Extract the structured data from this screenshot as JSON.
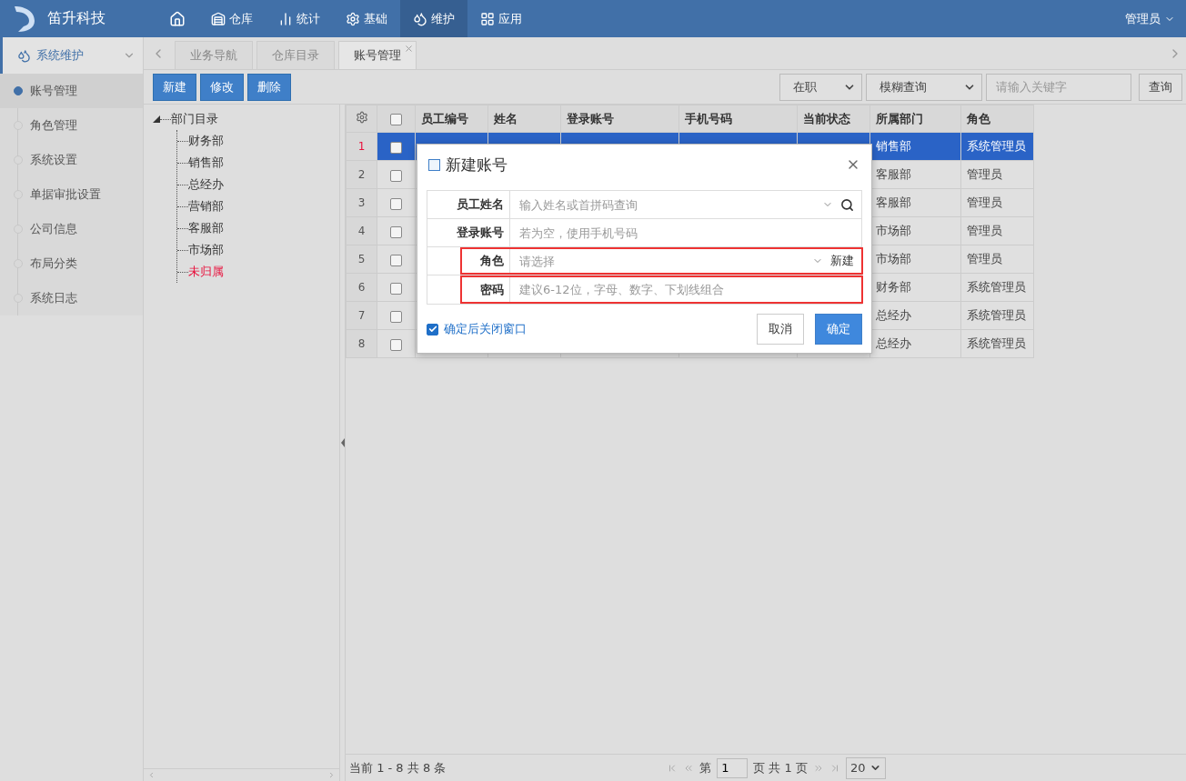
{
  "header": {
    "brand": "笛升科技",
    "nav": [
      {
        "label": "仓库",
        "selected": false
      },
      {
        "label": "统计",
        "selected": false
      },
      {
        "label": "基础",
        "selected": false
      },
      {
        "label": "维护",
        "selected": true
      },
      {
        "label": "应用",
        "selected": false
      }
    ],
    "user": "管理员"
  },
  "sidebar": {
    "group": {
      "label": "系统维护",
      "expanded": true
    },
    "items": [
      {
        "label": "账号管理",
        "selected": true
      },
      {
        "label": "角色管理",
        "selected": false
      },
      {
        "label": "系统设置",
        "selected": false
      },
      {
        "label": "单据审批设置",
        "selected": false
      },
      {
        "label": "公司信息",
        "selected": false
      },
      {
        "label": "布局分类",
        "selected": false
      },
      {
        "label": "系统日志",
        "selected": false
      }
    ]
  },
  "tabs": [
    {
      "label": "业务导航",
      "selected": false
    },
    {
      "label": "仓库目录",
      "selected": false
    },
    {
      "label": "账号管理",
      "selected": true,
      "closable": true
    }
  ],
  "toolbar": {
    "buttons": [
      "新建",
      "修改",
      "删除"
    ],
    "status_filter": "在职",
    "mode_filter": "模糊查询",
    "search": {
      "placeholder": "请输入关键字"
    },
    "search_button": "查询"
  },
  "tree": {
    "label": "部门目录",
    "expanded": true,
    "children": [
      {
        "label": "财务部",
        "color": "#333333"
      },
      {
        "label": "销售部",
        "color": "#333333"
      },
      {
        "label": "总经办",
        "color": "#333333"
      },
      {
        "label": "营销部",
        "color": "#333333"
      },
      {
        "label": "客服部",
        "color": "#333333"
      },
      {
        "label": "市场部",
        "color": "#333333"
      },
      {
        "label": "未归属",
        "color": "#e8103c"
      }
    ]
  },
  "table": {
    "all_checked": false,
    "columns": [
      "员工编号",
      "姓名",
      "登录账号",
      "手机号码",
      "当前状态",
      "所属部门",
      "角色"
    ],
    "rows": [
      {
        "index": "1",
        "selected": true,
        "checked": false,
        "department": "销售部",
        "role": "系统管理员"
      },
      {
        "index": "2",
        "selected": false,
        "checked": false,
        "department": "客服部",
        "role": "管理员"
      },
      {
        "index": "3",
        "selected": false,
        "checked": false,
        "department": "客服部",
        "role": "管理员"
      },
      {
        "index": "4",
        "selected": false,
        "checked": false,
        "department": "市场部",
        "role": "管理员"
      },
      {
        "index": "5",
        "selected": false,
        "checked": false,
        "department": "市场部",
        "role": "管理员"
      },
      {
        "index": "6",
        "selected": false,
        "checked": false,
        "department": "财务部",
        "role": "系统管理员"
      },
      {
        "index": "7",
        "selected": false,
        "checked": false,
        "department": "总经办",
        "role": "系统管理员"
      },
      {
        "index": "8",
        "selected": false,
        "checked": false,
        "department": "总经办",
        "role": "系统管理员"
      }
    ]
  },
  "pager": {
    "summary": "当前 1 - 8 共 8 条",
    "page_prefix": "第",
    "page": "1",
    "page_suffix": "页 共 1 页",
    "page_size": "20"
  },
  "dialog": {
    "title": "新建账号",
    "fields": [
      {
        "label": "员工姓名",
        "kind": "search",
        "placeholder": "输入姓名或首拼码查询",
        "highlighted": false
      },
      {
        "label": "登录账号",
        "kind": "text",
        "placeholder": "若为空，使用手机号码",
        "highlighted": false
      },
      {
        "label": "角色",
        "kind": "select",
        "placeholder": "请选择",
        "action": "新建",
        "highlighted": true
      },
      {
        "label": "密码",
        "kind": "text",
        "placeholder": "建议6-12位，字母、数字、下划线组合",
        "highlighted": true
      }
    ],
    "close_after_confirm": {
      "label": "确定后关闭窗口",
      "checked": true
    },
    "buttons": [
      {
        "label": "取消",
        "primary": false
      },
      {
        "label": "确定",
        "primary": true
      }
    ]
  }
}
